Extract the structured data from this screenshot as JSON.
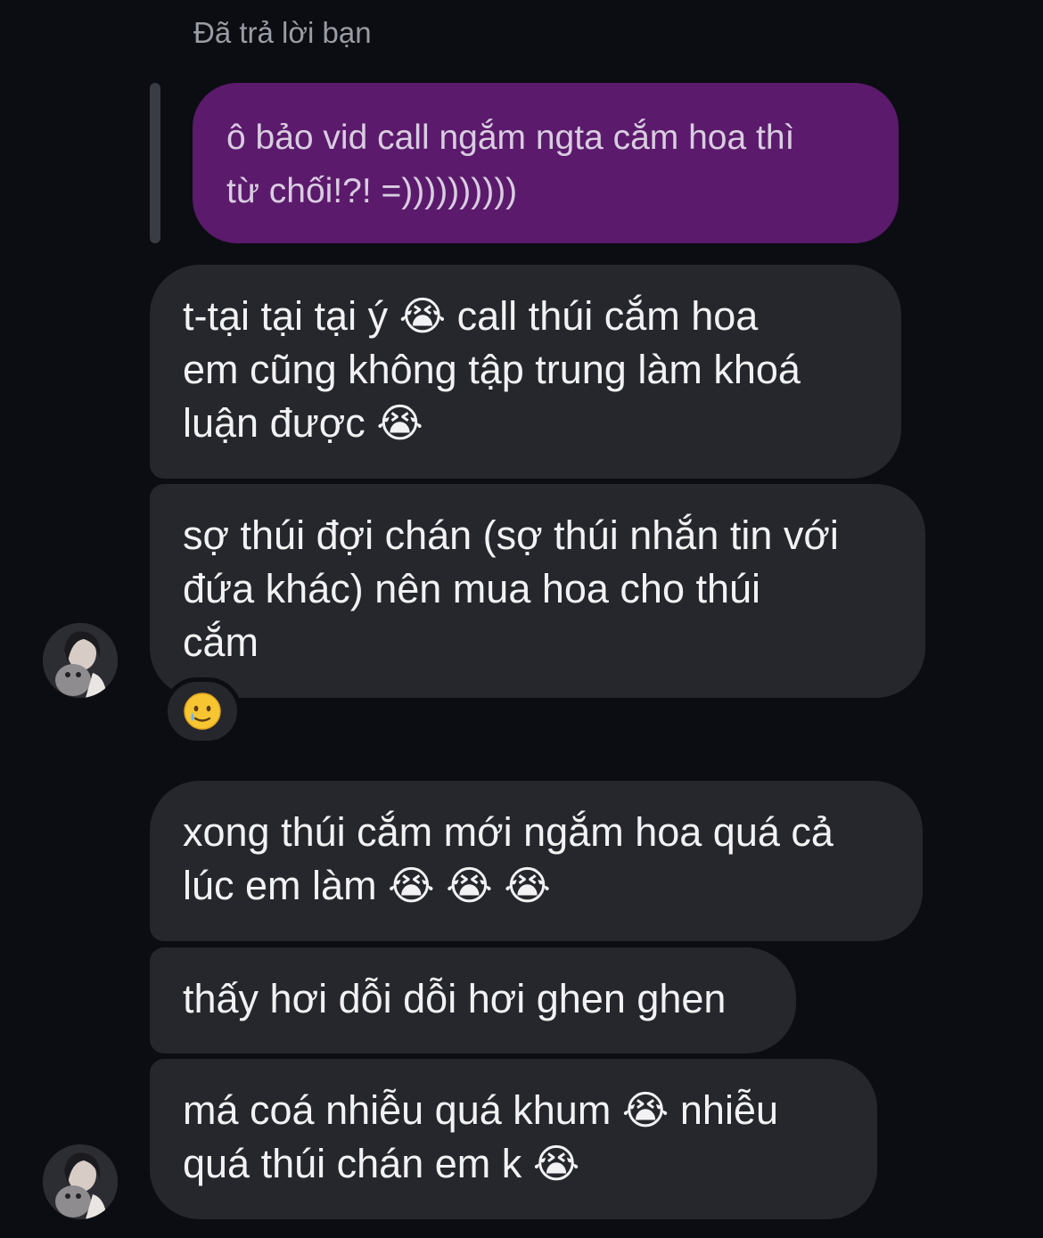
{
  "reply": {
    "label": "Đã trả lời bạn",
    "quoted_message": "ô bảo vid call ngắm ngta cắm hoa thì\ntừ chối!?! =))))))))))"
  },
  "messages": [
    {
      "text": "t-tại tại tại ý 😭 call thúi cắm hoa\nem cũng không tập trung làm khoá\nluận được 😭"
    },
    {
      "text": "sợ thúi đợi chán (sợ thúi nhắn tin với\nđứa khác) nên mua hoa cho thúi\ncắm",
      "reaction": "🥲"
    },
    {
      "text": "xong thúi cắm mới ngắm hoa quá cả\nlúc em làm 😭 😭 😭"
    },
    {
      "text": "thấy hơi dỗi dỗi hơi ghen ghen"
    },
    {
      "text": "má coá nhiễu quá khum 😭 nhiễu\nquá thúi chán em k 😭"
    }
  ],
  "colors": {
    "background": "#0b0d12",
    "incoming_bubble": "#26272d",
    "quoted_bubble": "#5b1a6c",
    "reply_bar": "#3a3c44"
  },
  "icons": {
    "avatar": "contact-avatar-icon",
    "reaction": "sad-tear-smile-emoji"
  }
}
